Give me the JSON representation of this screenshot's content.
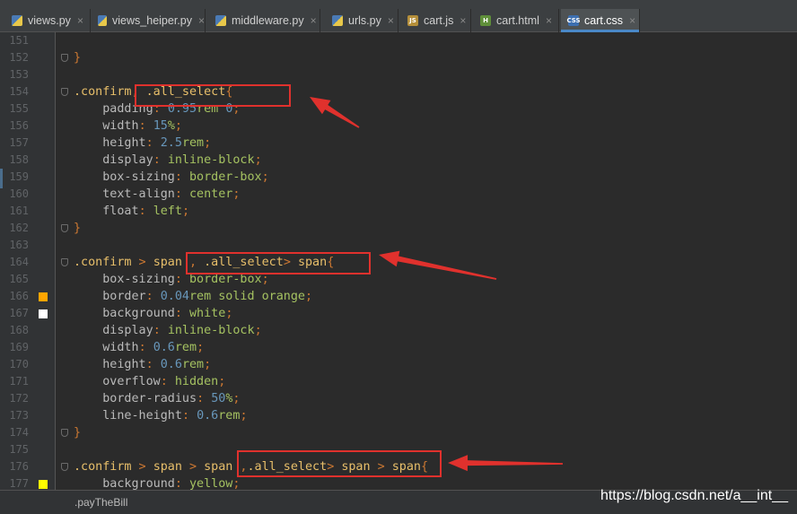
{
  "tabs": [
    {
      "label": "views.py",
      "icon": "python-file-icon",
      "active": false
    },
    {
      "label": "views_heiper.py",
      "icon": "python-file-icon",
      "active": false
    },
    {
      "label": "middleware.py",
      "icon": "python-file-icon",
      "active": false
    },
    {
      "label": "urls.py",
      "icon": "python-file-icon",
      "active": false
    },
    {
      "label": "cart.js",
      "icon": "js-file-icon",
      "active": false
    },
    {
      "label": "cart.html",
      "icon": "html-file-icon",
      "active": false
    },
    {
      "label": "cart.css",
      "icon": "css-file-icon",
      "active": true
    }
  ],
  "tab_close_glyph": "×",
  "editor": {
    "line_numbers": [
      "151",
      "152",
      "153",
      "154",
      "155",
      "156",
      "157",
      "158",
      "159",
      "160",
      "161",
      "162",
      "163",
      "164",
      "165",
      "166",
      "167",
      "168",
      "169",
      "170",
      "171",
      "172",
      "173",
      "174",
      "175",
      "176",
      "177"
    ],
    "color_swatches": {
      "166": "#ffa500",
      "167": "#ffffff",
      "177": "#ffff00"
    },
    "lines": [
      [],
      [
        {
          "t": "}",
          "c": "pun"
        }
      ],
      [],
      [
        {
          "t": ".confirm",
          "c": "sel"
        },
        {
          "t": ", ",
          "c": "pun"
        },
        {
          "t": ".all_select",
          "c": "sel"
        },
        {
          "t": "{",
          "c": "pun"
        }
      ],
      [
        {
          "t": "    "
        },
        {
          "t": "padding",
          "c": "prop"
        },
        {
          "t": ": ",
          "c": "pun"
        },
        {
          "t": "0.95",
          "c": "num"
        },
        {
          "t": "rem ",
          "c": "val"
        },
        {
          "t": "0",
          "c": "num"
        },
        {
          "t": ";",
          "c": "pun"
        }
      ],
      [
        {
          "t": "    "
        },
        {
          "t": "width",
          "c": "prop"
        },
        {
          "t": ": ",
          "c": "pun"
        },
        {
          "t": "15",
          "c": "num"
        },
        {
          "t": "%",
          "c": "val"
        },
        {
          "t": ";",
          "c": "pun"
        }
      ],
      [
        {
          "t": "    "
        },
        {
          "t": "height",
          "c": "prop"
        },
        {
          "t": ": ",
          "c": "pun"
        },
        {
          "t": "2.5",
          "c": "num"
        },
        {
          "t": "rem",
          "c": "val"
        },
        {
          "t": ";",
          "c": "pun"
        }
      ],
      [
        {
          "t": "    "
        },
        {
          "t": "display",
          "c": "prop"
        },
        {
          "t": ": ",
          "c": "pun"
        },
        {
          "t": "inline-block",
          "c": "val"
        },
        {
          "t": ";",
          "c": "pun"
        }
      ],
      [
        {
          "t": "    "
        },
        {
          "t": "box-sizing",
          "c": "prop"
        },
        {
          "t": ": ",
          "c": "pun"
        },
        {
          "t": "border-box",
          "c": "val"
        },
        {
          "t": ";",
          "c": "pun"
        }
      ],
      [
        {
          "t": "    "
        },
        {
          "t": "text-align",
          "c": "prop"
        },
        {
          "t": ": ",
          "c": "pun"
        },
        {
          "t": "center",
          "c": "val"
        },
        {
          "t": ";",
          "c": "pun"
        }
      ],
      [
        {
          "t": "    "
        },
        {
          "t": "float",
          "c": "prop"
        },
        {
          "t": ": ",
          "c": "pun"
        },
        {
          "t": "left",
          "c": "val"
        },
        {
          "t": ";",
          "c": "pun"
        }
      ],
      [
        {
          "t": "}",
          "c": "pun"
        }
      ],
      [],
      [
        {
          "t": ".confirm",
          "c": "sel"
        },
        {
          "t": " > ",
          "c": "pun"
        },
        {
          "t": "span",
          "c": "sel"
        },
        {
          "t": " , ",
          "c": "pun"
        },
        {
          "t": ".all_select",
          "c": "sel"
        },
        {
          "t": "> ",
          "c": "pun"
        },
        {
          "t": "span",
          "c": "sel"
        },
        {
          "t": "{",
          "c": "pun"
        }
      ],
      [
        {
          "t": "    "
        },
        {
          "t": "box-sizing",
          "c": "prop"
        },
        {
          "t": ": ",
          "c": "pun"
        },
        {
          "t": "border-box",
          "c": "val"
        },
        {
          "t": ";",
          "c": "pun"
        }
      ],
      [
        {
          "t": "    "
        },
        {
          "t": "border",
          "c": "prop"
        },
        {
          "t": ": ",
          "c": "pun"
        },
        {
          "t": "0.04",
          "c": "num"
        },
        {
          "t": "rem solid orange",
          "c": "val"
        },
        {
          "t": ";",
          "c": "pun"
        }
      ],
      [
        {
          "t": "    "
        },
        {
          "t": "background",
          "c": "prop"
        },
        {
          "t": ": ",
          "c": "pun"
        },
        {
          "t": "white",
          "c": "val"
        },
        {
          "t": ";",
          "c": "pun"
        }
      ],
      [
        {
          "t": "    "
        },
        {
          "t": "display",
          "c": "prop"
        },
        {
          "t": ": ",
          "c": "pun"
        },
        {
          "t": "inline-block",
          "c": "val"
        },
        {
          "t": ";",
          "c": "pun"
        }
      ],
      [
        {
          "t": "    "
        },
        {
          "t": "width",
          "c": "prop"
        },
        {
          "t": ": ",
          "c": "pun"
        },
        {
          "t": "0.6",
          "c": "num"
        },
        {
          "t": "rem",
          "c": "val"
        },
        {
          "t": ";",
          "c": "pun"
        }
      ],
      [
        {
          "t": "    "
        },
        {
          "t": "height",
          "c": "prop"
        },
        {
          "t": ": ",
          "c": "pun"
        },
        {
          "t": "0.6",
          "c": "num"
        },
        {
          "t": "rem",
          "c": "val"
        },
        {
          "t": ";",
          "c": "pun"
        }
      ],
      [
        {
          "t": "    "
        },
        {
          "t": "overflow",
          "c": "prop"
        },
        {
          "t": ": ",
          "c": "pun"
        },
        {
          "t": "hidden",
          "c": "val"
        },
        {
          "t": ";",
          "c": "pun"
        }
      ],
      [
        {
          "t": "    "
        },
        {
          "t": "border-radius",
          "c": "prop"
        },
        {
          "t": ": ",
          "c": "pun"
        },
        {
          "t": "50",
          "c": "num"
        },
        {
          "t": "%",
          "c": "val"
        },
        {
          "t": ";",
          "c": "pun"
        }
      ],
      [
        {
          "t": "    "
        },
        {
          "t": "line-height",
          "c": "prop"
        },
        {
          "t": ": ",
          "c": "pun"
        },
        {
          "t": "0.6",
          "c": "num"
        },
        {
          "t": "rem",
          "c": "val"
        },
        {
          "t": ";",
          "c": "pun"
        }
      ],
      [
        {
          "t": "}",
          "c": "pun"
        }
      ],
      [],
      [
        {
          "t": ".confirm",
          "c": "sel"
        },
        {
          "t": " > ",
          "c": "pun"
        },
        {
          "t": "span",
          "c": "sel"
        },
        {
          "t": " > ",
          "c": "pun"
        },
        {
          "t": "span",
          "c": "sel"
        },
        {
          "t": " ,",
          "c": "pun"
        },
        {
          "t": ".all_select",
          "c": "sel"
        },
        {
          "t": "> ",
          "c": "pun"
        },
        {
          "t": "span",
          "c": "sel"
        },
        {
          "t": " > ",
          "c": "pun"
        },
        {
          "t": "span",
          "c": "sel"
        },
        {
          "t": "{",
          "c": "pun"
        }
      ],
      [
        {
          "t": "    "
        },
        {
          "t": "background",
          "c": "prop"
        },
        {
          "t": ": ",
          "c": "pun"
        },
        {
          "t": "yellow",
          "c": "val"
        },
        {
          "t": ";",
          "c": "pun"
        }
      ]
    ]
  },
  "annotation_color": "#e0312d",
  "statusbar": {
    "breadcrumb": ".payTheBill"
  },
  "watermark": "https://blog.csdn.net/a__int__"
}
